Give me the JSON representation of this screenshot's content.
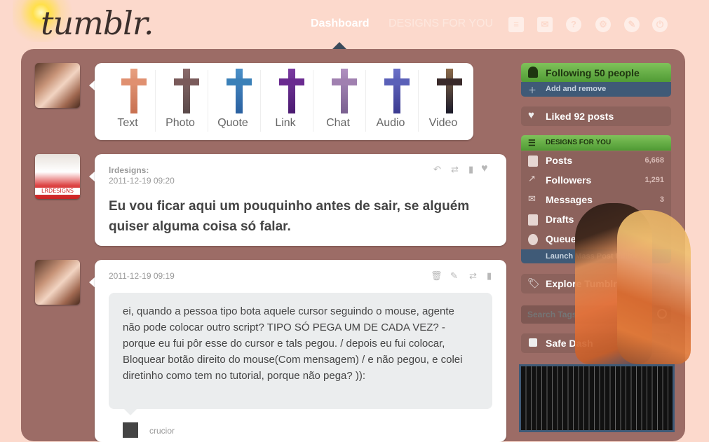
{
  "header": {
    "logo": "tumblr.",
    "nav": [
      {
        "label": "Dashboard",
        "active": true
      },
      {
        "label": "DESIGNS FOR YOU",
        "active": false
      }
    ],
    "icons": [
      "inbox-icon",
      "mail-icon",
      "help-icon",
      "settings-icon",
      "customize-icon",
      "logout-icon"
    ]
  },
  "post_types": [
    {
      "label": "Text",
      "colors": [
        "#e8a080",
        "#c87050"
      ]
    },
    {
      "label": "Photo",
      "colors": [
        "#8a6a6a",
        "#5a4a4a"
      ]
    },
    {
      "label": "Quote",
      "colors": [
        "#4a90c8",
        "#2a60a0"
      ]
    },
    {
      "label": "Link",
      "colors": [
        "#7a3aa0",
        "#4a1a70"
      ]
    },
    {
      "label": "Chat",
      "colors": [
        "#b090c0",
        "#7a6090"
      ]
    },
    {
      "label": "Audio",
      "colors": [
        "#6a70c8",
        "#3a3a90"
      ]
    },
    {
      "label": "Video",
      "colors": [
        "#8a6a4a",
        "#1a1a2a"
      ]
    }
  ],
  "posts": [
    {
      "author": "lrdesigns:",
      "timestamp": "2011-12-19 09:20",
      "text": "Eu vou ficar aqui um pouquinho antes de sair, se alguém quiser alguma coisa só falar.",
      "avatar_label": "LRDESIGNS"
    },
    {
      "timestamp": "2011-12-19 09:19",
      "ask": "ei, quando a pessoa tipo bota aquele cursor seguindo o mouse, agente não pode colocar outro script? TIPO SÓ PEGA UM DE CADA VEZ? - porque eu fui pôr esse do cursor e tals pegou. / depois eu fui colocar, Bloquear botão direito do mouse(Com mensagem) / e não pegou, e colei diretinho como tem no tutorial, porque não pega? )):",
      "asker": "crucior"
    }
  ],
  "sidebar": {
    "following": "Following 50 people",
    "add_remove": "Add and remove",
    "liked": "Liked 92 posts",
    "blog_title": "DESIGNS FOR YOU",
    "rows": [
      {
        "label": "Posts",
        "count": "6,668"
      },
      {
        "label": "Followers",
        "count": "1,291"
      },
      {
        "label": "Messages",
        "count": "3"
      },
      {
        "label": "Drafts",
        "count": ""
      },
      {
        "label": "Queue",
        "count": ""
      }
    ],
    "mass_editor": "Launch Mass Post Editor",
    "explore": "Explore Tumblr",
    "search_placeholder": "Search Tags",
    "safe_dash": "Safe Dash"
  },
  "colors": {
    "background": "#fcd9cc",
    "panel": "#9c6c66",
    "green": "#5aa83c",
    "navy": "#3f5a77"
  }
}
